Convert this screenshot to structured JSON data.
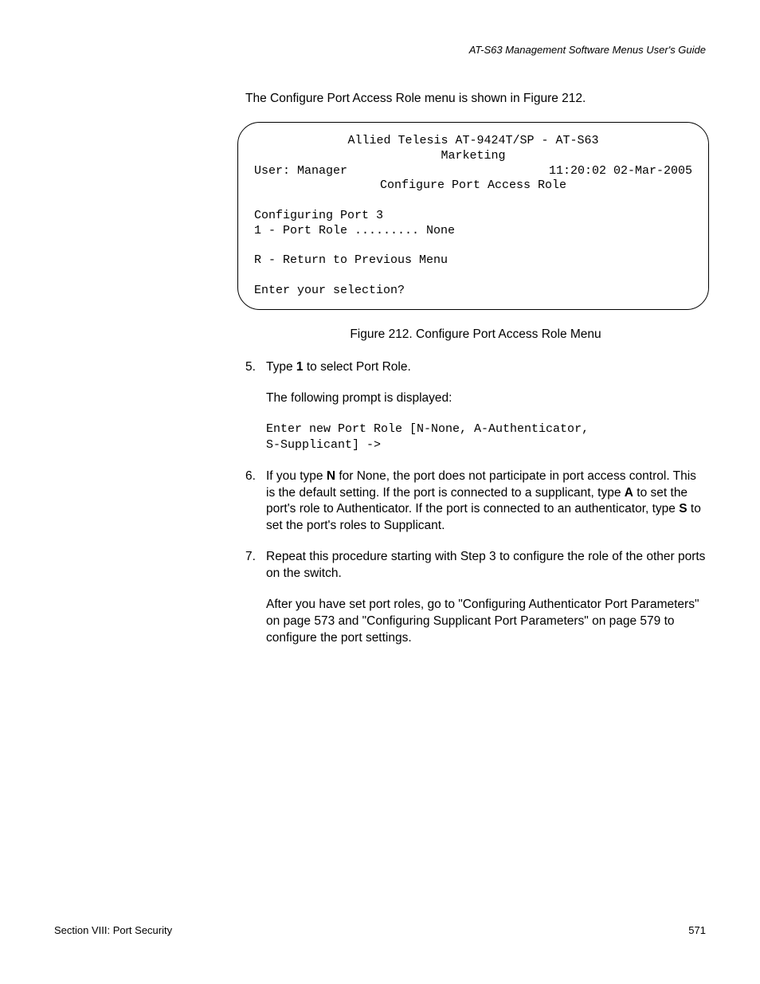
{
  "header": {
    "guide_title": "AT-S63 Management Software Menus User's Guide"
  },
  "intro": "The Configure Port Access Role menu is shown in Figure 212.",
  "terminal": {
    "title_line": "Allied Telesis AT-9424T/SP - AT-S63",
    "subtitle": "Marketing",
    "user_label": "User: Manager",
    "timestamp": "11:20:02 02-Mar-2005",
    "menu_title": "Configure Port Access Role",
    "config_line": "Configuring Port 3",
    "option1": "1 - Port Role ......... None",
    "return_line": "R - Return to Previous Menu",
    "prompt": "Enter your selection?"
  },
  "figure_caption": "Figure 212. Configure Port Access Role Menu",
  "steps": {
    "s5": {
      "num": "5.",
      "text_a": "Type ",
      "bold_a": "1",
      "text_b": " to select Port Role.",
      "para1": "The following prompt is displayed:",
      "code1": "Enter new Port Role [N-None, A-Authenticator,",
      "code2": "S-Supplicant] ->"
    },
    "s6": {
      "num": "6.",
      "t1": "If you type ",
      "b1": "N",
      "t2": " for None, the port does not participate in port access control. This is the default setting. If the port is connected to a supplicant, type ",
      "b2": "A",
      "t3": " to set the port's role to Authenticator. If the port is connected to an authenticator, type ",
      "b3": "S",
      "t4": " to set the port's roles to Supplicant."
    },
    "s7": {
      "num": "7.",
      "text": "Repeat this procedure starting with Step 3 to configure the role of the other ports on the switch.",
      "para": "After you have set port roles, go to \"Configuring Authenticator Port Parameters\" on page 573 and \"Configuring Supplicant Port Parameters\" on page 579 to configure the port settings."
    }
  },
  "footer": {
    "section": "Section VIII: Port Security",
    "page": "571"
  }
}
